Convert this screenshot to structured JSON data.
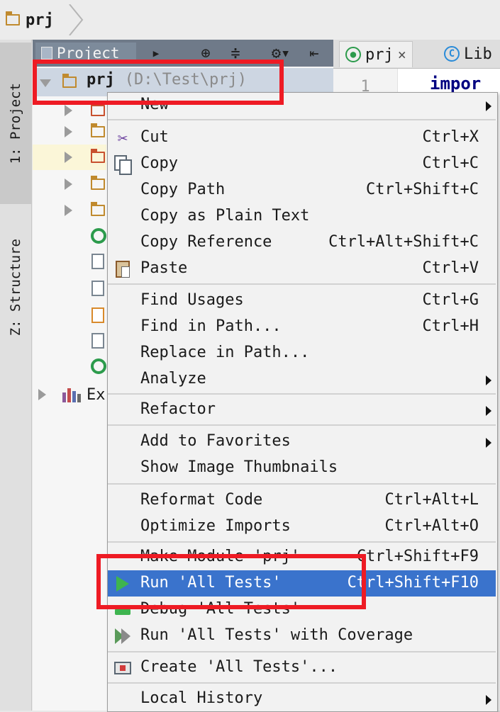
{
  "breadcrumb": {
    "project": "prj"
  },
  "tool_strip": {
    "tab_project": "1: Project",
    "tab_structure": "Z: Structure"
  },
  "project_panel": {
    "title": "Project",
    "root": {
      "name": "prj",
      "path": "(D:\\Test\\prj)"
    },
    "external_node_label": "Ex"
  },
  "editor": {
    "tabs": [
      {
        "label": "prj",
        "close": "×"
      },
      {
        "label": "Lib"
      }
    ],
    "line_number": "1",
    "code_fragment": "impor"
  },
  "context_menu": {
    "items": [
      {
        "label": "New",
        "shortcut": "",
        "submenu": true
      },
      {
        "label": "Cut",
        "shortcut": "Ctrl+X",
        "icon": "scissors-icon"
      },
      {
        "label": "Copy",
        "shortcut": "Ctrl+C",
        "icon": "copy-icon"
      },
      {
        "label": "Copy Path",
        "shortcut": "Ctrl+Shift+C"
      },
      {
        "label": "Copy as Plain Text",
        "shortcut": ""
      },
      {
        "label": "Copy Reference",
        "shortcut": "Ctrl+Alt+Shift+C"
      },
      {
        "label": "Paste",
        "shortcut": "Ctrl+V",
        "icon": "paste-icon"
      },
      {
        "label": "Find Usages",
        "shortcut": "Ctrl+G"
      },
      {
        "label": "Find in Path...",
        "shortcut": "Ctrl+H"
      },
      {
        "label": "Replace in Path...",
        "shortcut": ""
      },
      {
        "label": "Analyze",
        "shortcut": "",
        "submenu": true
      },
      {
        "label": "Refactor",
        "shortcut": "",
        "submenu": true
      },
      {
        "label": "Add to Favorites",
        "shortcut": "",
        "submenu": true
      },
      {
        "label": "Show Image Thumbnails",
        "shortcut": ""
      },
      {
        "label": "Reformat Code",
        "shortcut": "Ctrl+Alt+L"
      },
      {
        "label": "Optimize Imports",
        "shortcut": "Ctrl+Alt+O"
      },
      {
        "label": "Make Module 'prj'",
        "shortcut": "Ctrl+Shift+F9"
      },
      {
        "label": "Run 'All Tests'",
        "shortcut": "Ctrl+Shift+F10",
        "icon": "run-icon",
        "selected": true
      },
      {
        "label": "Debug 'All Tests'",
        "shortcut": "",
        "icon": "debug-icon"
      },
      {
        "label": "Run 'All Tests' with Coverage",
        "shortcut": "",
        "icon": "coverage-icon"
      },
      {
        "label": "Create 'All Tests'...",
        "shortcut": "",
        "icon": "create-icon"
      },
      {
        "label": "Local History",
        "shortcut": "",
        "submenu": true
      }
    ]
  },
  "colors": {
    "selection": "#3a73cc",
    "annotation": "#ee1b24",
    "panel_header": "#6f7a89"
  }
}
